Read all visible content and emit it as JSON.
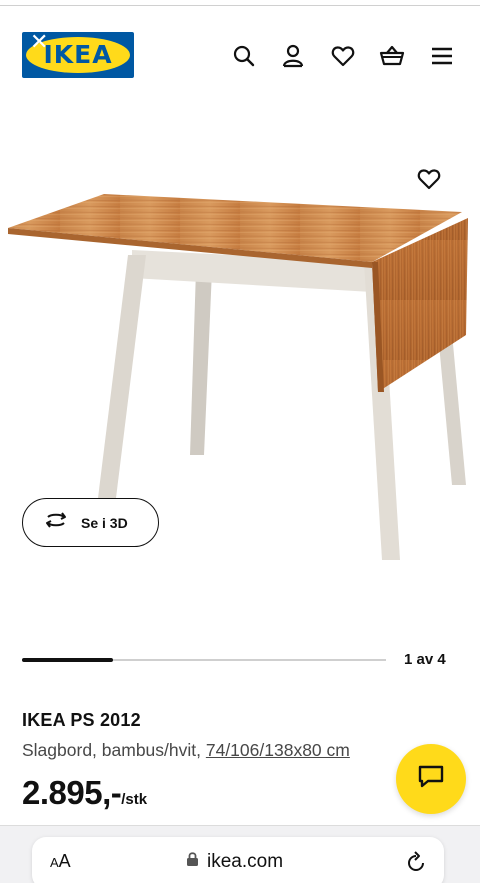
{
  "header": {
    "logo_text": "IKEA",
    "close_symbol": "✕",
    "icons": [
      "search-icon",
      "user-icon",
      "heart-icon",
      "basket-icon",
      "menu-icon"
    ]
  },
  "gallery": {
    "favorite_icon": "heart-icon",
    "see_3d_label": "Se i 3D",
    "counter": "1 av 4",
    "progress_fraction": 0.25
  },
  "product": {
    "name": "IKEA PS 2012",
    "description_prefix": "Slagbord, bambus/hvit, ",
    "dimensions": "74/106/138x80 cm",
    "price": "2.895,-",
    "unit": "/stk"
  },
  "chat": {
    "icon": "chat-icon"
  },
  "browser": {
    "aa_label_small": "A",
    "aa_label_large": "A",
    "url": "ikea.com",
    "icons": [
      "lock-icon",
      "reload-icon"
    ]
  },
  "colors": {
    "ikea_blue": "#0058a3",
    "ikea_yellow": "#ffda1a",
    "text": "#111111",
    "muted_text": "#484848"
  }
}
